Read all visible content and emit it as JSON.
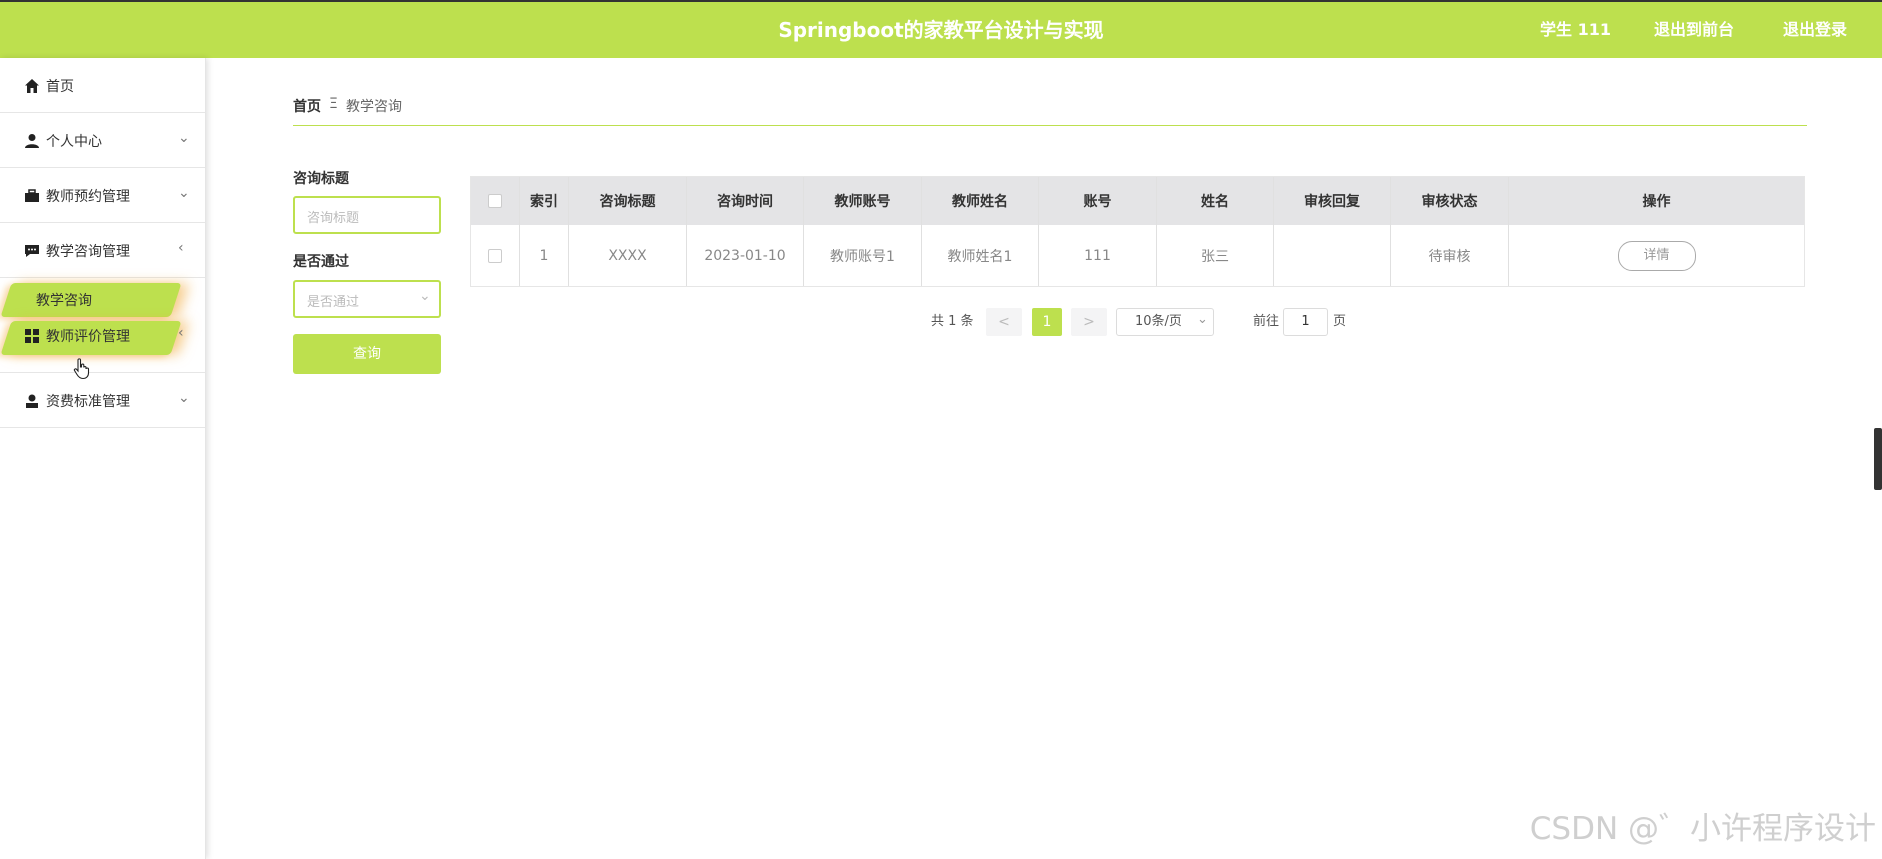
{
  "header": {
    "title": "Springboot的家教平台设计与实现",
    "user_label": "学生 111",
    "front_label": "退出到前台",
    "logout_label": "退出登录"
  },
  "sidebar": {
    "items": [
      {
        "label": "首页",
        "icon": "home-icon"
      },
      {
        "label": "个人中心",
        "icon": "person-icon"
      },
      {
        "label": "教师预约管理",
        "icon": "briefcase-icon"
      },
      {
        "label": "教学咨询管理",
        "icon": "chat-icon"
      },
      {
        "label": "教学咨询",
        "icon": ""
      },
      {
        "label": "教师评价管理",
        "icon": "grid-icon"
      },
      {
        "label": "资费标准管理",
        "icon": "user-icon"
      }
    ]
  },
  "breadcrumb": {
    "home": "首页",
    "separator": "Ξ",
    "current": "教学咨询"
  },
  "search": {
    "title_label": "咨询标题",
    "title_placeholder": "咨询标题",
    "pass_label": "是否通过",
    "pass_placeholder": "是否通过",
    "query_label": "查询"
  },
  "table": {
    "columns": [
      "索引",
      "咨询标题",
      "咨询时间",
      "教师账号",
      "教师姓名",
      "账号",
      "姓名",
      "审核回复",
      "审核状态",
      "操作"
    ],
    "rows": [
      {
        "index": "1",
        "title": "XXXX",
        "time": "2023-01-10",
        "teacher_account": "教师账号1",
        "teacher_name": "教师姓名1",
        "account": "111",
        "name": "张三",
        "reply": "",
        "status": "待审核",
        "action": "详情"
      }
    ]
  },
  "pagination": {
    "total": "共 1 条",
    "prev": "<",
    "current_page": "1",
    "next": ">",
    "page_size": "10条/页",
    "goto_label": "前往",
    "goto_value": "1",
    "page_suffix": "页"
  },
  "watermark": "CSDN @゛小许程序设计",
  "colors": {
    "accent": "#bde04e",
    "brush_glow": "#f0aa3c"
  }
}
